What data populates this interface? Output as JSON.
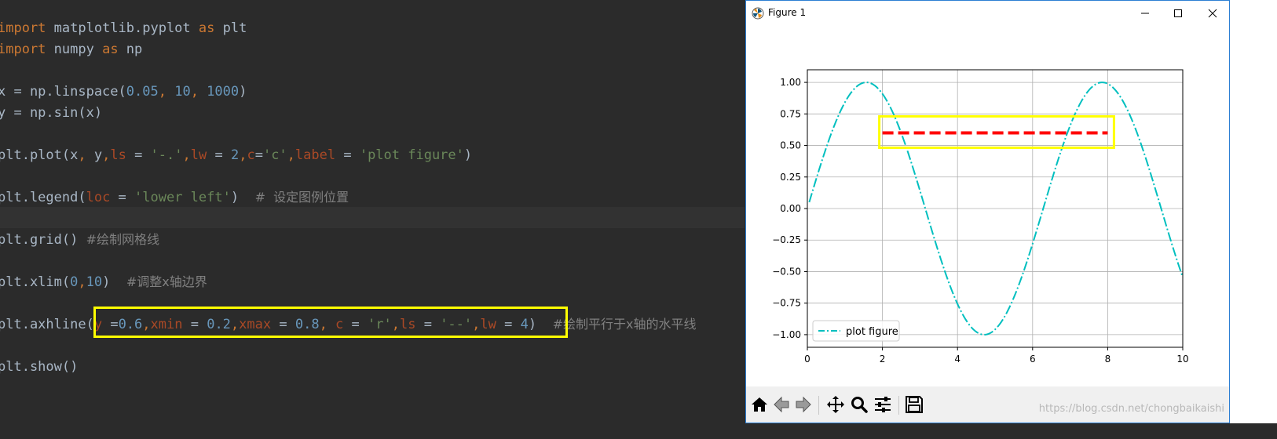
{
  "editor": {
    "lines": [
      {
        "top": 36,
        "tokens": [
          {
            "t": "import",
            "c": "t-kw"
          },
          {
            "t": " matplotlib.pyplot ",
            "c": ""
          },
          {
            "t": "as",
            "c": "t-kw"
          },
          {
            "t": " plt",
            "c": ""
          }
        ]
      },
      {
        "top": 63,
        "tokens": [
          {
            "t": "import",
            "c": "t-kw"
          },
          {
            "t": " numpy ",
            "c": ""
          },
          {
            "t": "as",
            "c": "t-kw"
          },
          {
            "t": " np",
            "c": ""
          }
        ]
      },
      {
        "top": 117,
        "tokens": [
          {
            "t": "x = np.linspace(",
            "c": ""
          },
          {
            "t": "0.05",
            "c": "t-num"
          },
          {
            "t": ", ",
            "c": "t-kw"
          },
          {
            "t": "10",
            "c": "t-num"
          },
          {
            "t": ", ",
            "c": "t-kw"
          },
          {
            "t": "1000",
            "c": "t-num"
          },
          {
            "t": ")",
            "c": ""
          }
        ]
      },
      {
        "top": 144,
        "tokens": [
          {
            "t": "y = np.sin(x)",
            "c": ""
          }
        ]
      },
      {
        "top": 198,
        "tokens": [
          {
            "t": "plt.plot(x",
            "c": ""
          },
          {
            "t": ", ",
            "c": "t-kw"
          },
          {
            "t": "y",
            "c": ""
          },
          {
            "t": ",",
            "c": "t-kw"
          },
          {
            "t": "ls",
            "c": "t-param"
          },
          {
            "t": " = ",
            "c": ""
          },
          {
            "t": "'-.'",
            "c": "t-str"
          },
          {
            "t": ",",
            "c": "t-kw"
          },
          {
            "t": "lw",
            "c": "t-param"
          },
          {
            "t": " = ",
            "c": ""
          },
          {
            "t": "2",
            "c": "t-num"
          },
          {
            "t": ",",
            "c": "t-kw"
          },
          {
            "t": "c",
            "c": "t-param"
          },
          {
            "t": "=",
            "c": ""
          },
          {
            "t": "'c'",
            "c": "t-str"
          },
          {
            "t": ",",
            "c": "t-kw"
          },
          {
            "t": "label",
            "c": "t-param"
          },
          {
            "t": " = ",
            "c": ""
          },
          {
            "t": "'plot figure'",
            "c": "t-str"
          },
          {
            "t": ")",
            "c": ""
          }
        ]
      },
      {
        "top": 252,
        "tokens": [
          {
            "t": "plt.legend(",
            "c": ""
          },
          {
            "t": "loc",
            "c": "t-param"
          },
          {
            "t": " = ",
            "c": ""
          },
          {
            "t": "'lower left'",
            "c": "t-str"
          },
          {
            "t": ")  ",
            "c": ""
          },
          {
            "t": "#  设定图例位置",
            "c": "t-cm"
          }
        ]
      },
      {
        "top": 306,
        "tokens": [
          {
            "t": "plt.grid() ",
            "c": ""
          },
          {
            "t": "#绘制网格线",
            "c": "t-cm"
          }
        ]
      },
      {
        "top": 360,
        "tokens": [
          {
            "t": "plt.xlim(",
            "c": ""
          },
          {
            "t": "0",
            "c": "t-num"
          },
          {
            "t": ",",
            "c": "t-kw"
          },
          {
            "t": "10",
            "c": "t-num"
          },
          {
            "t": ")  ",
            "c": ""
          },
          {
            "t": "#调整x轴边界",
            "c": "t-cm"
          }
        ]
      },
      {
        "top": 414,
        "tokens": [
          {
            "t": "plt.axhline(",
            "c": ""
          },
          {
            "t": "y",
            "c": "t-param"
          },
          {
            "t": " =",
            "c": ""
          },
          {
            "t": "0.6",
            "c": "t-num"
          },
          {
            "t": ",",
            "c": "t-kw"
          },
          {
            "t": "xmin",
            "c": "t-param"
          },
          {
            "t": " = ",
            "c": ""
          },
          {
            "t": "0.2",
            "c": "t-num"
          },
          {
            "t": ",",
            "c": "t-kw"
          },
          {
            "t": "xmax",
            "c": "t-param"
          },
          {
            "t": " = ",
            "c": ""
          },
          {
            "t": "0.8",
            "c": "t-num"
          },
          {
            "t": ", ",
            "c": "t-kw"
          },
          {
            "t": "c",
            "c": "t-param"
          },
          {
            "t": " = ",
            "c": ""
          },
          {
            "t": "'r'",
            "c": "t-str"
          },
          {
            "t": ",",
            "c": "t-kw"
          },
          {
            "t": "ls",
            "c": "t-param"
          },
          {
            "t": " = ",
            "c": ""
          },
          {
            "t": "'--'",
            "c": "t-str"
          },
          {
            "t": ",",
            "c": "t-kw"
          },
          {
            "t": "lw",
            "c": "t-param"
          },
          {
            "t": " = ",
            "c": ""
          },
          {
            "t": "4",
            "c": "t-num"
          },
          {
            "t": ")  ",
            "c": ""
          },
          {
            "t": "#绘制平行于x轴的水平线",
            "c": "t-cm"
          }
        ]
      },
      {
        "top": 468,
        "tokens": [
          {
            "t": "plt.show()",
            "c": ""
          }
        ]
      }
    ]
  },
  "figure_window": {
    "title": "Figure 1",
    "minimize_icon": "minimize-icon",
    "maximize_icon": "maximize-icon",
    "close_icon": "close-icon",
    "toolbar": {
      "buttons": [
        "home-icon",
        "back-arrow-icon",
        "forward-arrow-icon",
        "pan-icon",
        "zoom-icon",
        "subplots-icon",
        "save-icon"
      ]
    },
    "watermark": "https://blog.csdn.net/chongbaikaishi"
  },
  "chart_data": {
    "type": "line",
    "title": "",
    "xlabel": "",
    "ylabel": "",
    "xlim": [
      0,
      10
    ],
    "ylim": [
      -1.1,
      1.1
    ],
    "xticks": [
      0,
      2,
      4,
      6,
      8,
      10
    ],
    "xtick_labels": [
      "0",
      "2",
      "4",
      "6",
      "8",
      "10"
    ],
    "yticks": [
      1.0,
      0.75,
      0.5,
      0.25,
      0.0,
      -0.25,
      -0.5,
      -0.75,
      -1.0
    ],
    "ytick_labels": [
      "1.00",
      "0.75",
      "0.50",
      "0.25",
      "0.00",
      "−0.25",
      "−0.50",
      "−0.75",
      "−1.00"
    ],
    "grid": true,
    "series": [
      {
        "name": "plot figure",
        "function": "sin",
        "x_start": 0.05,
        "x_end": 10,
        "color": "#00bfbf",
        "linestyle": "dashdot"
      }
    ],
    "hline": {
      "y": 0.6,
      "xmin_frac": 0.2,
      "xmax_frac": 0.8,
      "color": "#ff0000",
      "linestyle": "dashed"
    },
    "legend": {
      "position": "lower-left",
      "entries": [
        "plot figure"
      ]
    },
    "highlight_color": "#ffff00"
  }
}
